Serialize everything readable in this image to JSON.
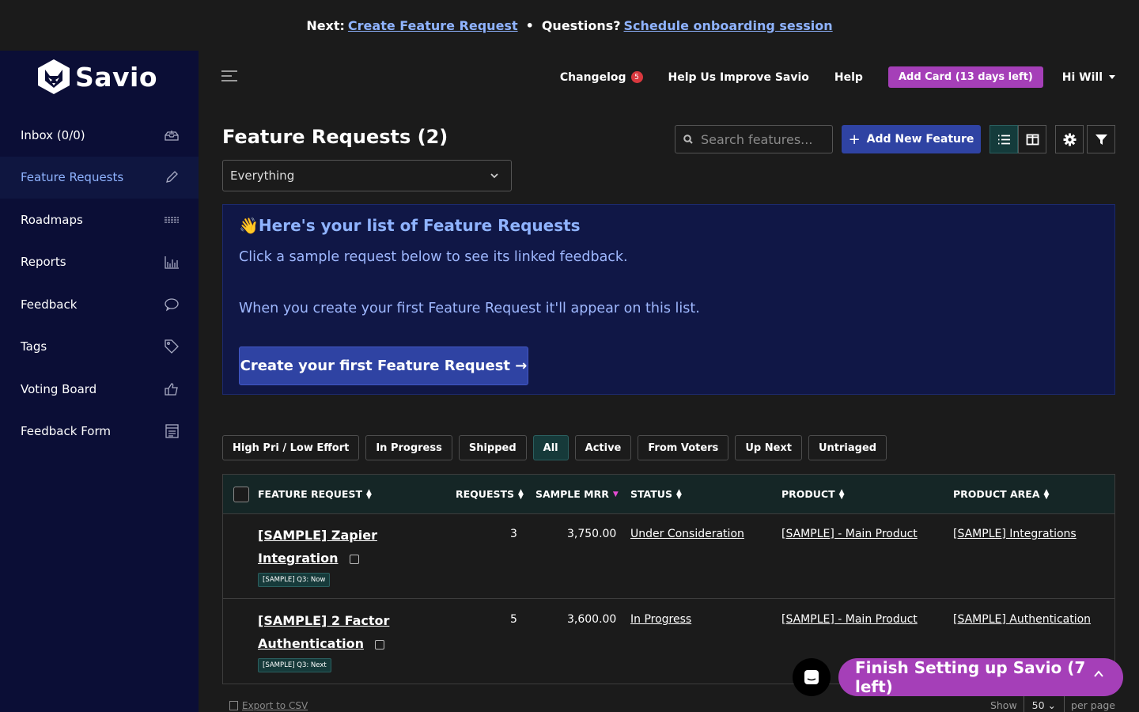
{
  "topbar": {
    "next_label": "Next:",
    "next_link": "Create Feature Request",
    "separator": "•",
    "questions_label": "Questions?",
    "questions_link": "Schedule onboarding session"
  },
  "brand": {
    "name": "Savio"
  },
  "sidebar": {
    "items": [
      {
        "label": "Inbox (0/0)",
        "icon": "inbox-icon"
      },
      {
        "label": "Feature Requests",
        "icon": "pencil-icon",
        "active": true
      },
      {
        "label": "Roadmaps",
        "icon": "roadmap-icon"
      },
      {
        "label": "Reports",
        "icon": "bar-chart-icon"
      },
      {
        "label": "Feedback",
        "icon": "chat-bubble-icon"
      },
      {
        "label": "Tags",
        "icon": "tag-icon"
      },
      {
        "label": "Voting Board",
        "icon": "thumbs-up-icon"
      },
      {
        "label": "Feedback Form",
        "icon": "form-icon"
      }
    ]
  },
  "header": {
    "changelog": "Changelog",
    "changelog_count": "5",
    "improve": "Help Us Improve Savio",
    "help": "Help",
    "add_card": "Add Card (13 days left)",
    "user": "Hi Will"
  },
  "page": {
    "title": "Feature Requests (2)",
    "filter_value": "Everything",
    "search_placeholder": "Search features...",
    "add_button": "Add New Feature",
    "add_plus": "+"
  },
  "info": {
    "heading": "👋Here's your list of Feature Requests",
    "line1": "Click a sample request below to see its linked feedback.",
    "line2": "When you create your first Feature Request it'll appear on this list.",
    "cta": "Create your first Feature Request →"
  },
  "chips": [
    "High Pri / Low Effort",
    "In Progress",
    "Shipped",
    "All",
    "Active",
    "From Voters",
    "Up Next",
    "Untriaged"
  ],
  "chips_selected": "All",
  "table": {
    "columns": [
      "FEATURE REQUEST",
      "REQUESTS",
      "SAMPLE MRR",
      "STATUS",
      "PRODUCT",
      "PRODUCT AREA"
    ],
    "rows": [
      {
        "title": "[SAMPLE] Zapier Integration",
        "tag": "[SAMPLE] Q3: Now",
        "requests": "3",
        "mrr": "3,750.00",
        "status": "Under Consideration",
        "product": "[SAMPLE] - Main Product",
        "area": "[SAMPLE] Integrations"
      },
      {
        "title": "[SAMPLE] 2 Factor Authentication",
        "tag": "[SAMPLE] Q3: Next",
        "requests": "5",
        "mrr": "3,600.00",
        "status": "In Progress",
        "product": "[SAMPLE] - Main Product",
        "area": "[SAMPLE] Authentication"
      }
    ]
  },
  "footer": {
    "export": "Export to CSV",
    "show": "Show",
    "per_page_value": "50",
    "per_page": "per page"
  },
  "floating": {
    "finish": "Finish Setting up Savio (7 left)"
  },
  "colors": {
    "sidebar_bg": "#0b0e36",
    "accent_blue": "#2f43a3",
    "accent_purple": "#a53fb8",
    "link_blue": "#8fb3ff"
  }
}
